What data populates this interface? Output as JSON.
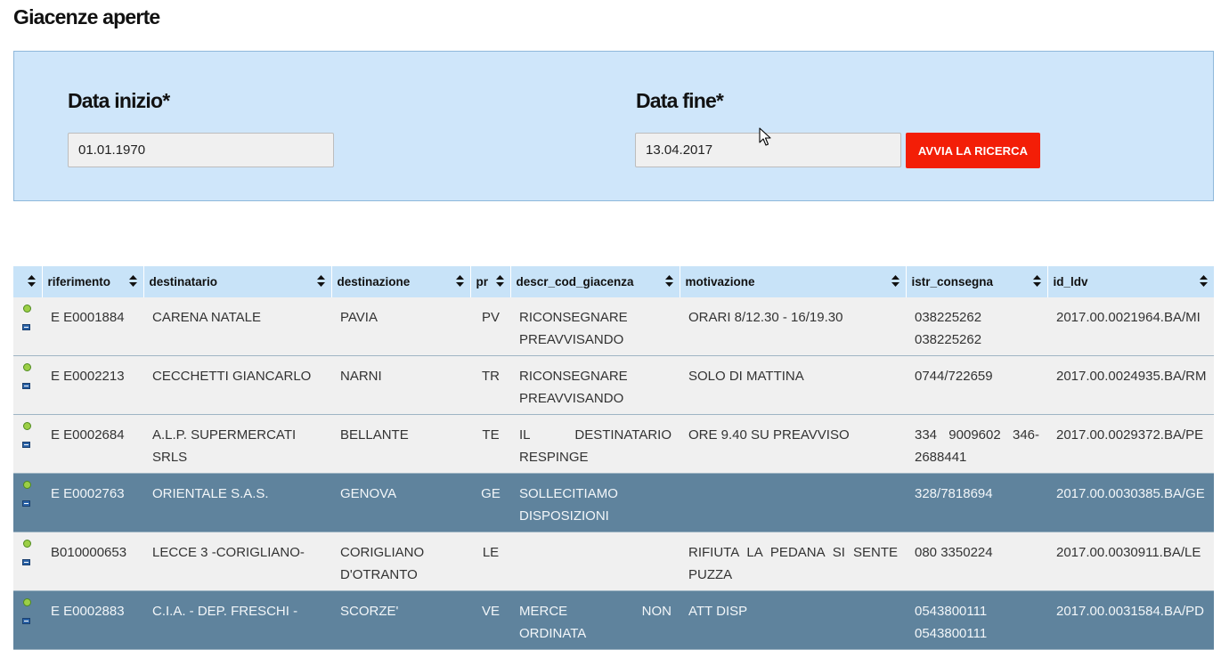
{
  "page": {
    "title": "Giacenze aperte"
  },
  "search": {
    "start_label": "Data inizio*",
    "start_value": "01.01.1970",
    "end_label": "Data fine*",
    "end_value": "13.04.2017",
    "button_label": "AVVIA LA RICERCA",
    "button_color": "#f31e07",
    "panel_color": "#cfe6fa"
  },
  "table": {
    "columns": [
      "",
      "riferimento",
      "destinatario",
      "destinazione",
      "pr",
      "descr_cod_giacenza",
      "motivazione",
      "istr_consegna",
      "id_ldv"
    ],
    "row_icons": [
      "green-dot-icon",
      "document-icon"
    ],
    "rows": [
      {
        "style": "light",
        "riferimento": "E E0001884",
        "destinatario": "CARENA NATALE",
        "destinazione": "PAVIA",
        "pr": "PV",
        "descr": "RICONSEGNARE PREAVVISANDO",
        "motivazione": "ORARI 8/12.30 - 16/19.30",
        "istr": "038225262 038225262",
        "id_ldv": "2017.00.0021964.BA/MI"
      },
      {
        "style": "light",
        "riferimento": "E E0002213",
        "destinatario": "CECCHETTI GIANCARLO",
        "destinazione": "NARNI",
        "pr": "TR",
        "descr": "RICONSEGNARE PREAVVISANDO",
        "motivazione": "SOLO DI MATTINA",
        "istr": "0744/722659",
        "id_ldv": "2017.00.0024935.BA/RM"
      },
      {
        "style": "light",
        "riferimento": "E E0002684",
        "destinatario": "A.L.P. SUPERMERCATI SRLS",
        "destinazione": "BELLANTE",
        "pr": "TE",
        "descr": "IL DESTINATARIO RESPINGE",
        "motivazione": "ORE 9.40 SU PREAVVISO",
        "istr": "334 9009602 346-2688441",
        "id_ldv": "2017.00.0029372.BA/PE"
      },
      {
        "style": "dark",
        "riferimento": "E E0002763",
        "destinatario": "ORIENTALE S.A.S.",
        "destinazione": "GENOVA",
        "pr": "GE",
        "descr": "SOLLECITIAMO DISPOSIZIONI",
        "motivazione": "",
        "istr": "328/7818694",
        "id_ldv": "2017.00.0030385.BA/GE"
      },
      {
        "style": "light",
        "riferimento": "B010000653",
        "destinatario": "LECCE 3 -CORIGLIANO-",
        "destinazione": "CORIGLIANO D'OTRANTO",
        "pr": "LE",
        "descr": "",
        "motivazione": "RIFIUTA LA PEDANA SI SENTE PUZZA",
        "istr": "080 3350224",
        "id_ldv": "2017.00.0030911.BA/LE"
      },
      {
        "style": "dark",
        "riferimento": "E E0002883",
        "destinatario": "C.I.A. - DEP. FRESCHI -",
        "destinazione": "SCORZE'",
        "pr": "VE",
        "descr": "MERCE NON ORDINATA",
        "motivazione": "ATT DISP",
        "istr": "0543800111 0543800111",
        "id_ldv": "2017.00.0031584.BA/PD"
      }
    ]
  }
}
